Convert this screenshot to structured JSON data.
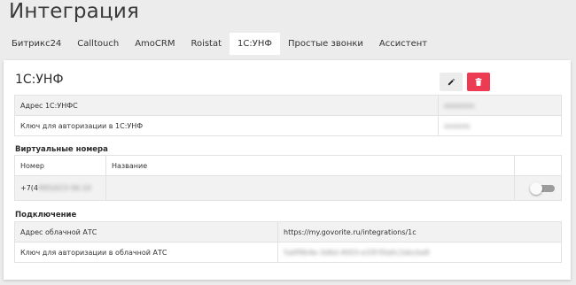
{
  "page": {
    "title": "Интеграция"
  },
  "tabs": [
    {
      "label": "Битрикс24",
      "active": false
    },
    {
      "label": "Calltouch",
      "active": false
    },
    {
      "label": "AmoCRM",
      "active": false
    },
    {
      "label": "Roistat",
      "active": false
    },
    {
      "label": "1С:УНФ",
      "active": true
    },
    {
      "label": "Простые звонки",
      "active": false
    },
    {
      "label": "Ассистент",
      "active": false
    }
  ],
  "card": {
    "title": "1С:УНФ",
    "edit_icon": "pencil-icon",
    "delete_icon": "trash-icon",
    "colors": {
      "delete": "#ec3b52",
      "edit": "#ececec"
    },
    "settings": [
      {
        "label": "Адрес 1С:УНФС",
        "value": "ооооооо"
      },
      {
        "label": "Ключ для авторизации в 1С:УНФ",
        "value": "оооооо"
      }
    ]
  },
  "virtual_numbers": {
    "title": "Виртуальные номера",
    "columns": {
      "number": "Номер",
      "name": "Название"
    },
    "rows": [
      {
        "number_prefix": "+7(4",
        "number_rest": "995)023-56-10",
        "name": "",
        "enabled": false
      }
    ]
  },
  "connection": {
    "title": "Подключение",
    "rows": [
      {
        "label": "Адрес облачной АТС",
        "value": "https://my.govorite.ru/integrations/1c",
        "blurred": false
      },
      {
        "label": "Ключ для авторизации в облачной АТС",
        "value": "5a0f9b4e-3d6d-4003-a33f-f0a0c2abcbe8",
        "blurred": true
      }
    ]
  }
}
